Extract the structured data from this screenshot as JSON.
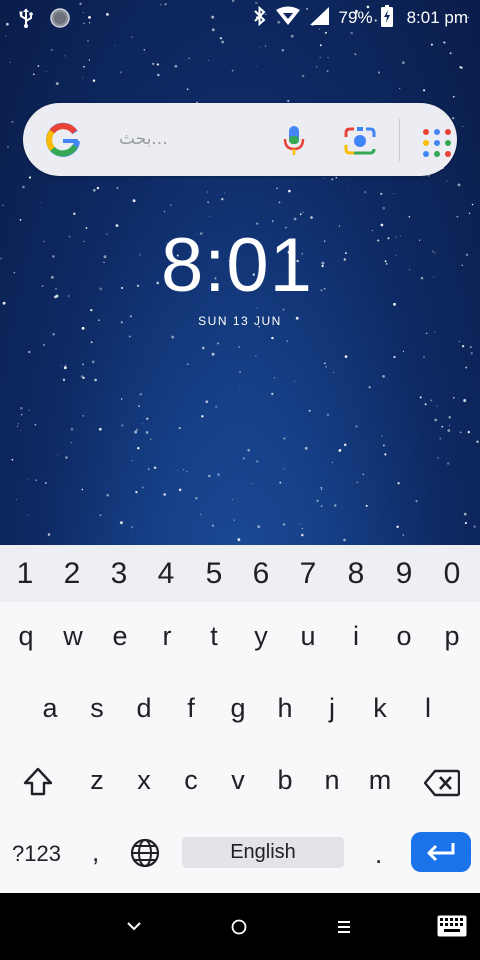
{
  "status_bar": {
    "icons_left": [
      "usb-icon",
      "moon-icon"
    ],
    "icons_right": [
      "bluetooth-icon",
      "wifi-icon",
      "signal-icon",
      "battery-charging-icon"
    ],
    "battery": "79%",
    "time": "8:01 pm"
  },
  "search": {
    "placeholder": "بحث...",
    "icons": [
      "google-logo",
      "mic-icon",
      "lens-icon",
      "apps-grid-icon"
    ]
  },
  "clock": {
    "time": "8:01",
    "date": "SUN 13 JUN"
  },
  "keyboard": {
    "number_row": [
      "1",
      "2",
      "3",
      "4",
      "5",
      "6",
      "7",
      "8",
      "9",
      "0"
    ],
    "row1": [
      "q",
      "w",
      "e",
      "r",
      "t",
      "y",
      "u",
      "i",
      "o",
      "p"
    ],
    "row2": [
      "a",
      "s",
      "d",
      "f",
      "g",
      "h",
      "j",
      "k",
      "l"
    ],
    "row3": [
      "z",
      "x",
      "c",
      "v",
      "b",
      "n",
      "m"
    ],
    "symbols_key": "?123",
    "comma_key": ",",
    "space_label": "English",
    "period_key": ".",
    "enter_color": "#1a73e8"
  },
  "nav_bar": {
    "buttons": [
      "chevron-down-icon",
      "home-circle-icon",
      "recents-icon",
      "keyboard-icon"
    ]
  }
}
